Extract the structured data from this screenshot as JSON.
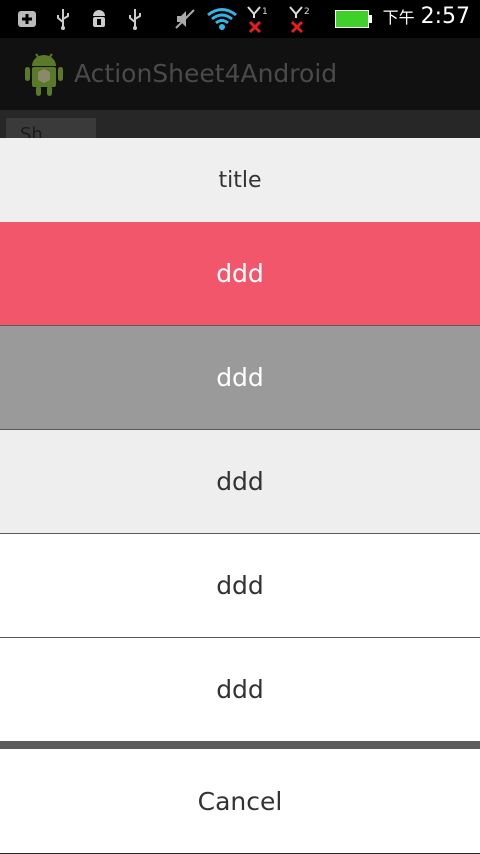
{
  "statusbar": {
    "ampm": "下午",
    "time": "2:57",
    "sim1_label": "1",
    "sim2_label": "2",
    "battery_color": "#3fd12b"
  },
  "actionbar": {
    "title": "ActionSheet4Android"
  },
  "content": {
    "show_button_label": "Sh"
  },
  "sheet": {
    "title": "title",
    "items": [
      {
        "label": "ddd",
        "bg": "#f2566b",
        "fg": "#ffffff"
      },
      {
        "label": "ddd",
        "bg": "#9a9a9a",
        "fg": "#ffffff"
      },
      {
        "label": "ddd",
        "bg": "#eeeeee",
        "fg": "#333333"
      },
      {
        "label": "ddd",
        "bg": "#ffffff",
        "fg": "#333333"
      },
      {
        "label": "ddd",
        "bg": "#ffffff",
        "fg": "#333333"
      }
    ],
    "cancel_label": "Cancel"
  }
}
